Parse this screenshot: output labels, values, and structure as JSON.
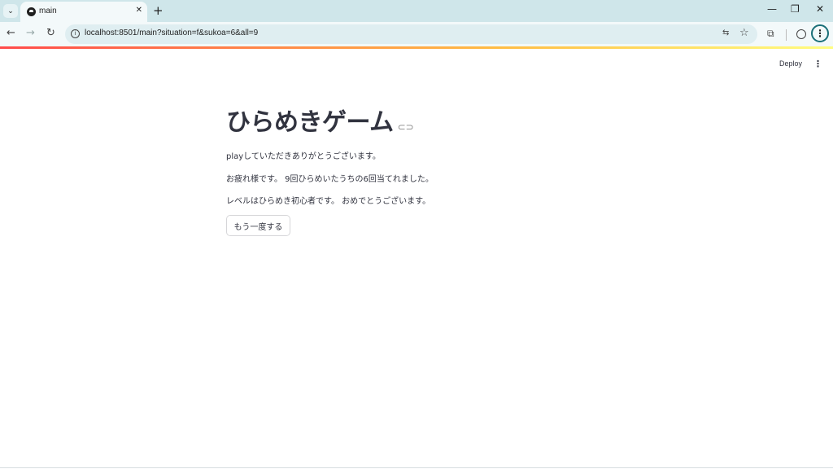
{
  "browser": {
    "tab_title": "main",
    "tab_close": "✕",
    "new_tab": "+",
    "url": "localhost:8501/main?situation=f&sukoa=6&all=9",
    "window_controls": {
      "minimize": "—",
      "restore": "❐",
      "close": "✕"
    }
  },
  "app_header": {
    "deploy_label": "Deploy",
    "menu_icon": "⋮"
  },
  "main": {
    "title": "ひらめきゲーム",
    "messages": [
      "playしていただきありがとうございます。",
      "お疲れ様です。 9回ひらめいたうちの6回当てれました。",
      "レベルはひらめき初心者です。 おめでとうございます。"
    ],
    "retry_button": "もう一度する"
  }
}
